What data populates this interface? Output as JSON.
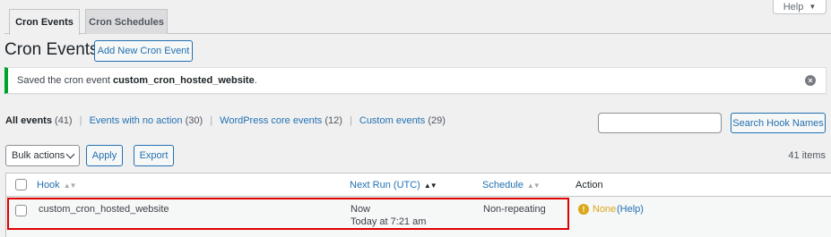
{
  "help_tab": {
    "label": "Help",
    "caret": "▼"
  },
  "tabs": [
    {
      "label": "Cron Events",
      "active": true
    },
    {
      "label": "Cron Schedules",
      "active": false
    }
  ],
  "page": {
    "title": "Cron Events",
    "add_button": "Add New Cron Event"
  },
  "notice": {
    "prefix": "Saved the cron event",
    "event_name": "custom_cron_hosted_website",
    "suffix": ".",
    "dismiss_icon": "close-circle-icon",
    "accent": "#00a32a"
  },
  "filters": [
    {
      "label": "All events",
      "count": "(41)",
      "current": true
    },
    {
      "label": "Events with no action",
      "count": "(30)",
      "current": false
    },
    {
      "label": "WordPress core events",
      "count": "(12)",
      "current": false
    },
    {
      "label": "Custom events",
      "count": "(29)",
      "current": false
    }
  ],
  "filter_separator": "|",
  "search": {
    "value": "",
    "button": "Search Hook Names"
  },
  "bulk": {
    "selected": "Bulk actions",
    "apply": "Apply",
    "export": "Export"
  },
  "items_count": "41 items",
  "table": {
    "headers": {
      "hook": "Hook",
      "next_run": "Next Run (UTC)",
      "schedule": "Schedule",
      "action": "Action"
    },
    "rows": [
      {
        "hook": "custom_cron_hosted_website",
        "next_run": "Now",
        "next_run_detail": "Today at 7:21 am",
        "schedule": "Non-repeating",
        "action_none": "None",
        "action_help": "(Help)",
        "action_icon": "warning-icon"
      }
    ]
  },
  "colors": {
    "link": "#2271b1",
    "highlight": "#e00000",
    "warning": "#dba617"
  }
}
